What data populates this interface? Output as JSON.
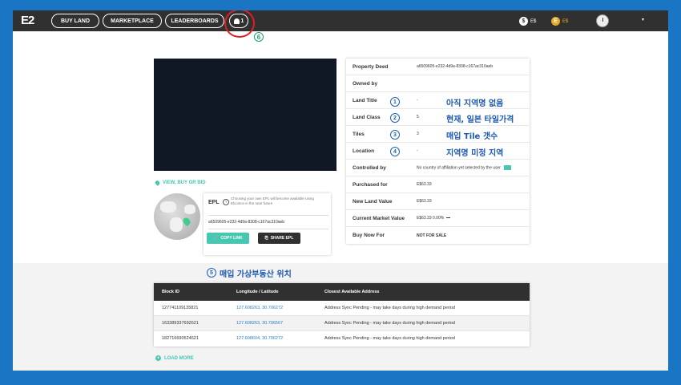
{
  "nav": {
    "logo": "E2",
    "buy_land": "BUY LAND",
    "marketplace": "MARKETPLACE",
    "leaderboards": "LEADERBOARDS",
    "notifications_count": "1",
    "currency_1": "E$",
    "currency_2": "E$",
    "coin_1_symbol": "$",
    "coin_2_symbol": "E",
    "caret": "▾"
  },
  "annotation_6": "6",
  "left": {
    "view_buy_bid": "VIEW, BUY OR BID",
    "epl_label": "EPL",
    "epl_info": "i",
    "epl_note": "Choosing your own EPL will become available using Elcoince in the near future",
    "epl_id": "a6509605-e232-4d9a-8308-c167ac310aeb",
    "copy_link": "COPY LINK",
    "share_epl": "SHARE EPL"
  },
  "property": {
    "rows": [
      {
        "label": "Property Deed",
        "value": "a6509605-e232-4d9a-8308-c167ac310aeb"
      },
      {
        "label": "Owned by",
        "value": ""
      },
      {
        "label": "Land Title",
        "value": "-"
      },
      {
        "label": "Land Class",
        "value": "5"
      },
      {
        "label": "Tiles",
        "value": "3"
      },
      {
        "label": "Location",
        "value": "-"
      },
      {
        "label": "Controlled by",
        "value": "No country of affiliation yet selected by the user"
      },
      {
        "label": "Purchased for",
        "value": "E$63.33"
      },
      {
        "label": "New Land Value",
        "value": "E$63.33"
      },
      {
        "label": "Current Market Value",
        "value": "E$63.33  0.00%"
      },
      {
        "label": "Buy Now For",
        "value": "NOT FOR SALE"
      }
    ]
  },
  "annotations": {
    "a1": {
      "num": "1",
      "text": "아직 지역명 없음"
    },
    "a2": {
      "num": "2",
      "text": "현재, 일본 타일가격"
    },
    "a3": {
      "num": "3",
      "text": "매입 Tile 갯수"
    },
    "a4": {
      "num": "4",
      "text": "지역명 미정 지역"
    },
    "a5": {
      "num": "5",
      "text": "매입 가상부동산 위치"
    }
  },
  "blocks": {
    "headers": [
      "Block ID",
      "Longitude / Latitude",
      "Closest Available Address"
    ],
    "rows": [
      {
        "id": "127741109135821",
        "coords": "127.608263, 30.706272",
        "address": "Address Sync Pending - may take days during high demand period"
      },
      {
        "id": "163389337692621",
        "coords": "127.608263, 30.706567",
        "address": "Address Sync Pending - may take days during high demand period"
      },
      {
        "id": "182716690524621",
        "coords": "127.608604, 30.706272",
        "address": "Address Sync Pending - may take days during high demand period"
      }
    ],
    "load_more": "LOAD MORE"
  },
  "colors": {
    "accent": "#45c7b0",
    "nav_bg": "#303030",
    "annotation_blue": "#1c58b0",
    "annotation_red": "#e02020"
  }
}
